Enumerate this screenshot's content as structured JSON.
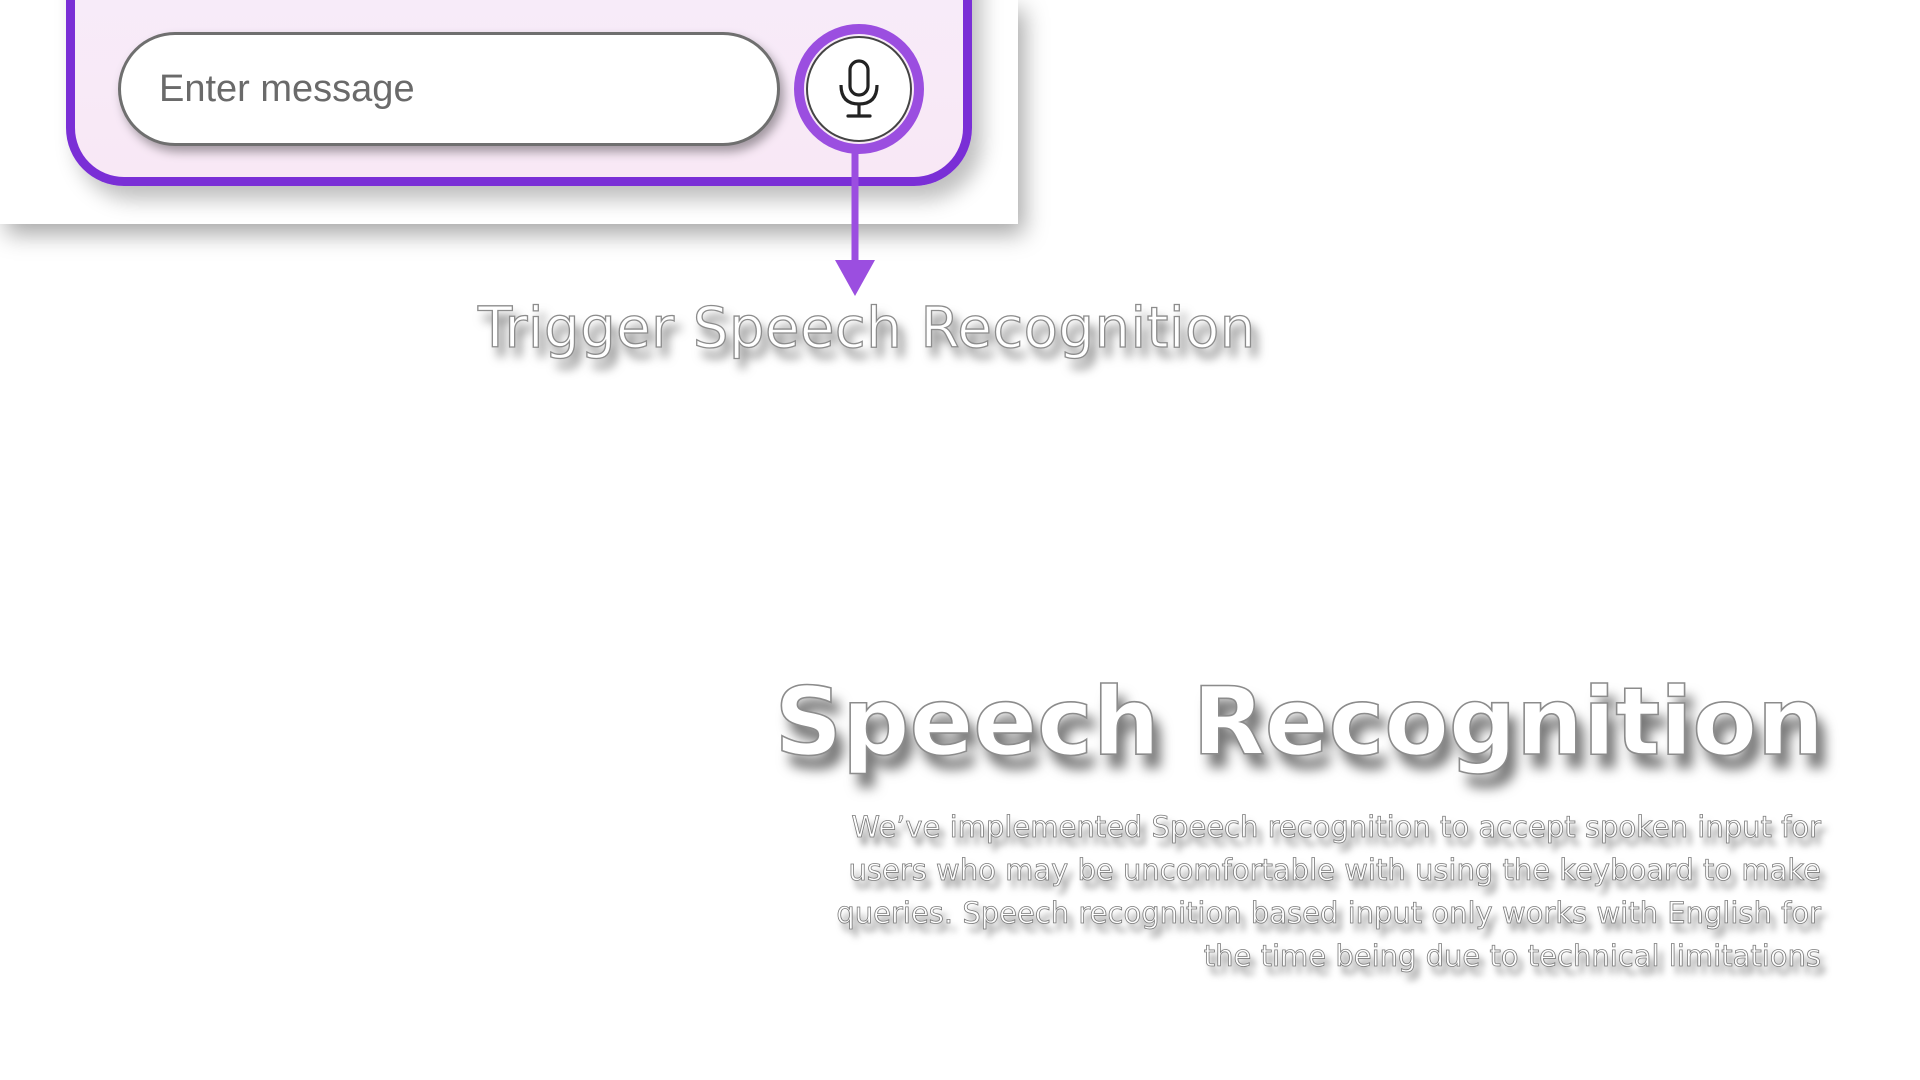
{
  "chat": {
    "input_placeholder": "Enter message",
    "mic_icon": "microphone-icon"
  },
  "callout": {
    "label": "Trigger Speech Recognition"
  },
  "section": {
    "title": "Speech Recognition",
    "body": "We’ve implemented Speech recognition to accept spoken input for users who may be uncomfortable with using the keyboard to make queries. Speech recognition based input only works with English for the time being due to technical limitations"
  },
  "colors": {
    "accent_purple": "#7a2fd6",
    "highlight_purple": "#9b4ee0",
    "chat_background": "#f7ecfa"
  }
}
